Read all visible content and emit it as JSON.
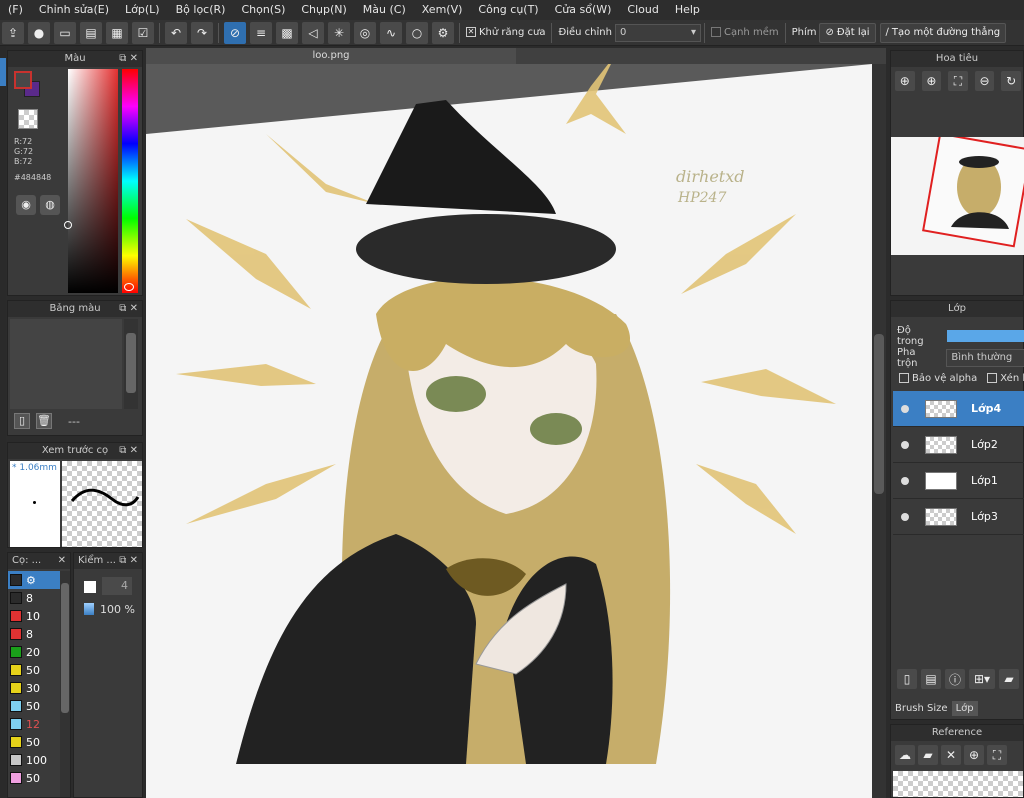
{
  "menu": [
    "(F)",
    "Chỉnh sửa(E)",
    "Lớp(L)",
    "Bộ lọc(R)",
    "Chọn(S)",
    "Chụp(N)",
    "Màu (C)",
    "Xem(V)",
    "Công cụ(T)",
    "Cửa sổ(W)",
    "Cloud",
    "Help"
  ],
  "toolbar": {
    "antialias_label": "Khử răng cưa",
    "adjust_label": "Điều chỉnh",
    "adjust_value": "0",
    "soft_edge_label": "Cạnh mềm",
    "key_label": "Phím",
    "reset_label": "Đặt lại",
    "straight_line_label": "Tạo một đường thẳng"
  },
  "color_panel": {
    "title": "Màu",
    "r": "R:72",
    "g": "G:72",
    "b": "B:72",
    "hex": "#484848",
    "fg_color": "#484848",
    "fg_border": "#c8322e"
  },
  "palette_panel": {
    "title": "Bảng màu",
    "dash": "---"
  },
  "brush_preview": {
    "title": "Xem trước cọ",
    "size": "* 1.06mm"
  },
  "brush_panel": {
    "title": "Cọ: ...",
    "items": [
      {
        "color": "#2b2b2b",
        "size": ""
      },
      {
        "color": "#2b2b2b",
        "size": "8"
      },
      {
        "color": "#e03232",
        "size": "10"
      },
      {
        "color": "#e03232",
        "size": "8"
      },
      {
        "color": "#1aa01a",
        "size": "20"
      },
      {
        "color": "#e6d21a",
        "size": "50"
      },
      {
        "color": "#e6d21a",
        "size": "30"
      },
      {
        "color": "#7ed0f0",
        "size": "50"
      },
      {
        "color": "#7ed0f0",
        "size": "12"
      },
      {
        "color": "#e6d21a",
        "size": "50"
      },
      {
        "color": "#c8c8c8",
        "size": "100"
      },
      {
        "color": "#f0a0e0",
        "size": "50"
      }
    ]
  },
  "check_panel": {
    "title": "Kiểm ...",
    "size_value": "4",
    "opacity_value": "100 %"
  },
  "canvas": {
    "tab_title": "loo.png",
    "signature": "dirhetxd HP247"
  },
  "navigator": {
    "title": "Hoa tiêu"
  },
  "layer_panel": {
    "title": "Lớp",
    "opacity_label": "Độ trong",
    "blend_label": "Pha trộn",
    "blend_value": "Bình thường",
    "protect_alpha": "Bảo vệ alpha",
    "clip_label": "Xén bơ",
    "layers": [
      {
        "name": "Lớp4",
        "active": true
      },
      {
        "name": "Lớp2",
        "active": false
      },
      {
        "name": "Lớp1",
        "active": false
      },
      {
        "name": "Lớp3",
        "active": false
      }
    ],
    "tab_brush_size": "Brush Size",
    "tab_layer": "Lớp"
  },
  "reference": {
    "title": "Reference"
  }
}
